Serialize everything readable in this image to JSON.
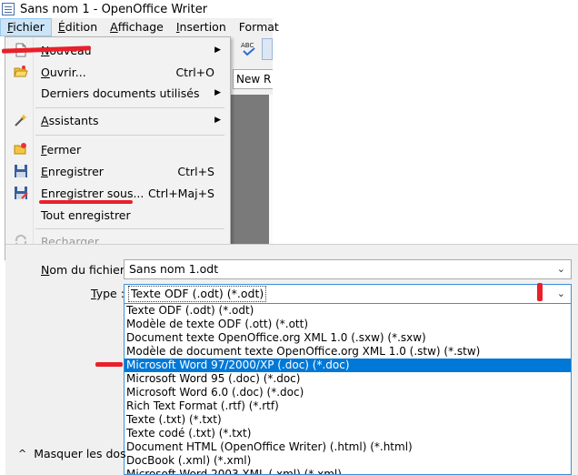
{
  "window": {
    "title": "Sans nom 1 - OpenOffice Writer"
  },
  "menubar": {
    "items": [
      {
        "label_u": "F",
        "label_rest": "ichier",
        "active": true
      },
      {
        "label_u": "É",
        "label_rest": "dition"
      },
      {
        "label_u": "A",
        "label_rest": "ffichage"
      },
      {
        "label_u": "I",
        "label_rest": "nsertion"
      },
      {
        "label_u": "",
        "label_rest": "Format"
      }
    ]
  },
  "toolbar": {
    "font_name_partial": "New R",
    "spellcheck_icon": "spellcheck-abc-icon"
  },
  "file_menu": {
    "items": [
      {
        "name": "nouveau",
        "u": "N",
        "rest": "ouveau",
        "shortcut": "",
        "submenu": true,
        "icon": "new-document-icon"
      },
      {
        "name": "ouvrir",
        "u": "O",
        "rest": "uvrir...",
        "shortcut": "Ctrl+O",
        "submenu": false,
        "icon": "open-folder-icon"
      },
      {
        "name": "derniers",
        "u": "",
        "rest": "Derniers documents utilisés",
        "shortcut": "",
        "submenu": true,
        "icon": ""
      },
      {
        "name": "assistants",
        "u": "A",
        "rest": "ssistants",
        "shortcut": "",
        "submenu": true,
        "icon": "wizard-icon"
      },
      {
        "name": "fermer",
        "u": "F",
        "rest": "ermer",
        "shortcut": "",
        "submenu": false,
        "icon": "close-document-icon"
      },
      {
        "name": "enregistrer",
        "u": "E",
        "rest": "nregistrer",
        "shortcut": "Ctrl+S",
        "submenu": false,
        "icon": "save-icon"
      },
      {
        "name": "enregistrer-sous",
        "u": "",
        "rest": "Enregistrer sous...",
        "shortcut": "Ctrl+Maj+S",
        "submenu": false,
        "icon": "save-as-icon"
      },
      {
        "name": "tout-enregistrer",
        "u": "",
        "rest": "Tout enregistrer",
        "shortcut": "",
        "submenu": false,
        "icon": ""
      },
      {
        "name": "recharger",
        "u": "",
        "rest": "Recharger",
        "shortcut": "",
        "submenu": false,
        "icon": "reload-icon",
        "disabled": true
      }
    ]
  },
  "save_dialog": {
    "filename_label_u": "N",
    "filename_label_rest": "om du fichier :",
    "filename_value": "Sans nom 1.odt",
    "type_label_u": "T",
    "type_label_rest": "ype :",
    "type_value": "Texte ODF (.odt) (*.odt)",
    "type_options": [
      "Texte ODF (.odt) (*.odt)",
      "Modèle de texte ODF (.ott) (*.ott)",
      "Document texte OpenOffice.org XML 1.0 (.sxw) (*.sxw)",
      "Modèle de document texte OpenOffice.org XML 1.0  (.stw) (*.stw)",
      "Microsoft Word 97/2000/XP (.doc) (*.doc)",
      "Microsoft Word 95 (.doc) (*.doc)",
      "Microsoft Word 6.0 (.doc) (*.doc)",
      "Rich Text Format (.rtf) (*.rtf)",
      "Texte (.txt) (*.txt)",
      "Texte codé (.txt) (*.txt)",
      "Document HTML (OpenOffice Writer) (.html) (*.html)",
      "DocBook (.xml) (*.xml)",
      "Microsoft Word 2003 XML (.xml) (*.xml)"
    ],
    "selected_option_index": 4,
    "collapse_label": "Masquer les dos"
  },
  "colors": {
    "annotation_red": "#e8202a",
    "selection_blue": "#0078d7",
    "focus_border": "#3d8fd9"
  }
}
